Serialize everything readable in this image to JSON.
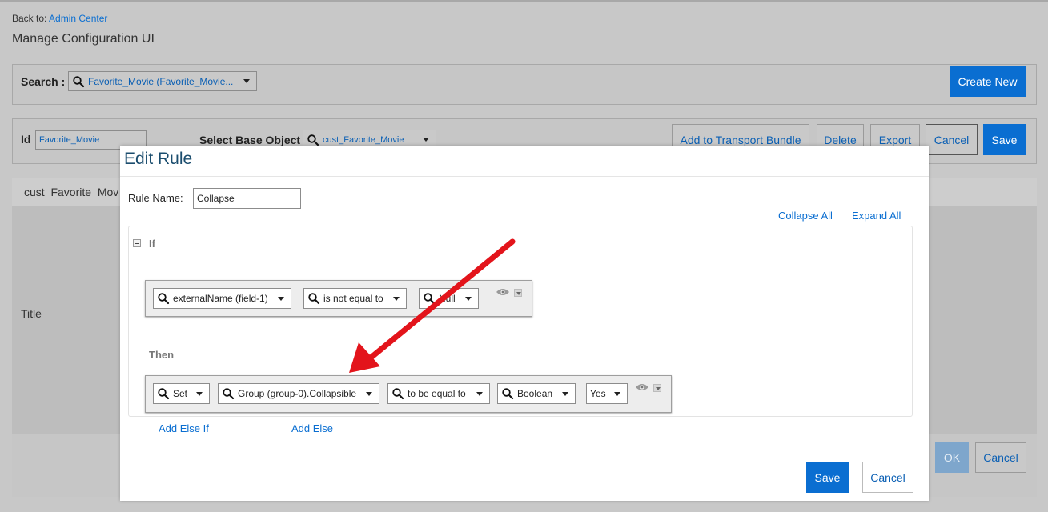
{
  "header": {
    "back_prefix": "Back to:",
    "back_link": "Admin Center",
    "page_title": "Manage Configuration UI"
  },
  "search": {
    "label": "Search :",
    "value": "Favorite_Movie (Favorite_Movie...",
    "create_new": "Create New"
  },
  "config": {
    "id_label": "Id",
    "id_value": "Favorite_Movie",
    "base_object_label": "Select Base Object",
    "base_object_value": "cust_Favorite_Movie",
    "buttons": {
      "add_to_transport": "Add to Transport Bundle",
      "delete": "Delete",
      "export": "Export",
      "cancel": "Cancel",
      "save": "Save"
    }
  },
  "background": {
    "section_title": "cust_Favorite_Mov",
    "field_label": "Title",
    "ok": "OK",
    "cancel": "Cancel"
  },
  "modal": {
    "title": "Edit Rule",
    "rule_name_label": "Rule Name:",
    "rule_name_value": "Collapse",
    "collapse_all": "Collapse All",
    "expand_all": "Expand All",
    "if_label": "If",
    "then_label": "Then",
    "if_row": {
      "field": "externalName (field-1)",
      "operator": "is not equal to",
      "value": "Null"
    },
    "then_row": {
      "action": "Set",
      "target": "Group (group-0).Collapsible",
      "operator": "to be equal to",
      "type": "Boolean",
      "value": "Yes"
    },
    "add_else_if": "Add Else If",
    "add_else": "Add Else",
    "save": "Save",
    "cancel": "Cancel"
  },
  "annotation": {
    "arrow_color": "#e3141b"
  }
}
